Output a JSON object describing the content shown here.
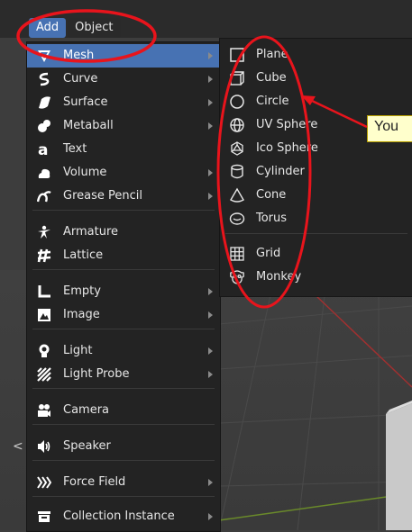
{
  "header": {
    "add_tab": "Add",
    "object_tab": "Object"
  },
  "add_menu": {
    "items": [
      {
        "label": "Mesh",
        "icon": "mesh-icon"
      },
      {
        "label": "Curve",
        "icon": "curve-icon"
      },
      {
        "label": "Surface",
        "icon": "surface-icon"
      },
      {
        "label": "Metaball",
        "icon": "metaball-icon"
      },
      {
        "label": "Text",
        "icon": "text-icon"
      },
      {
        "label": "Volume",
        "icon": "volume-icon"
      },
      {
        "label": "Grease Pencil",
        "icon": "grease-pencil-icon"
      },
      {
        "label": "Armature",
        "icon": "armature-icon"
      },
      {
        "label": "Lattice",
        "icon": "lattice-icon"
      },
      {
        "label": "Empty",
        "icon": "empty-icon"
      },
      {
        "label": "Image",
        "icon": "image-icon"
      },
      {
        "label": "Light",
        "icon": "light-icon"
      },
      {
        "label": "Light Probe",
        "icon": "light-probe-icon"
      },
      {
        "label": "Camera",
        "icon": "camera-icon"
      },
      {
        "label": "Speaker",
        "icon": "speaker-icon"
      },
      {
        "label": "Force Field",
        "icon": "force-field-icon"
      },
      {
        "label": "Collection Instance",
        "icon": "collection-instance-icon"
      }
    ]
  },
  "mesh_menu": {
    "items": [
      {
        "label": "Plane",
        "icon": "plane-icon"
      },
      {
        "label": "Cube",
        "icon": "cube-icon"
      },
      {
        "label": "Circle",
        "icon": "circle-icon"
      },
      {
        "label": "UV Sphere",
        "icon": "uv-sphere-icon"
      },
      {
        "label": "Ico Sphere",
        "icon": "ico-sphere-icon"
      },
      {
        "label": "Cylinder",
        "icon": "cylinder-icon"
      },
      {
        "label": "Cone",
        "icon": "cone-icon"
      },
      {
        "label": "Torus",
        "icon": "torus-icon"
      },
      {
        "label": "Grid",
        "icon": "grid-icon"
      },
      {
        "label": "Monkey",
        "icon": "monkey-icon"
      }
    ]
  },
  "callout": {
    "text": "You"
  },
  "colors": {
    "highlight": "#4772b3",
    "menu_bg": "#232323",
    "annotation": "#e8141c",
    "callout_bg": "#ffffcc"
  }
}
